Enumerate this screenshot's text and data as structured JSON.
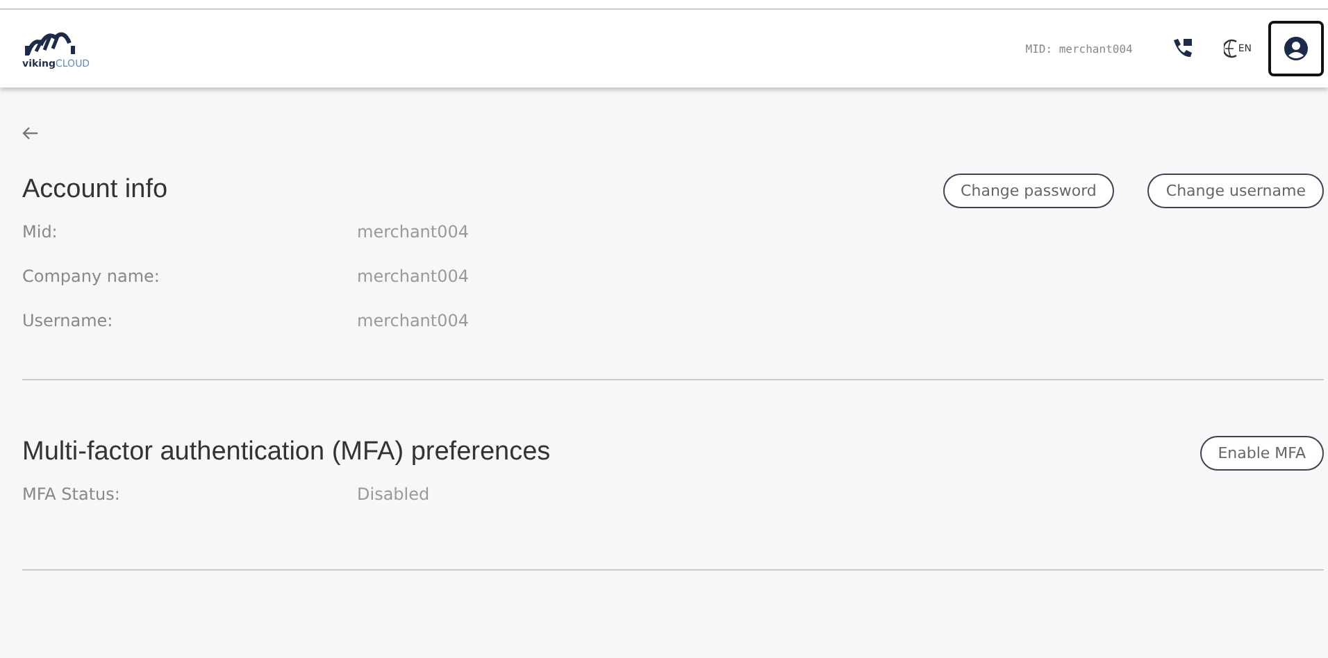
{
  "header": {
    "logo": {
      "word_bold": "viking",
      "word_light": "CLOUD"
    },
    "mid": "MID: merchant004",
    "language": "EN"
  },
  "sections": [
    {
      "title": "Account info",
      "buttons": [
        "Change password",
        "Change username"
      ],
      "rows": [
        {
          "label": "Mid:",
          "value": "merchant004"
        },
        {
          "label": "Company name:",
          "value": "merchant004"
        },
        {
          "label": "Username:",
          "value": "merchant004"
        }
      ]
    },
    {
      "title": "Multi-factor authentication (MFA) preferences",
      "buttons": [
        "Enable MFA"
      ],
      "rows": [
        {
          "label": "MFA Status:",
          "value": "Disabled"
        }
      ]
    }
  ]
}
